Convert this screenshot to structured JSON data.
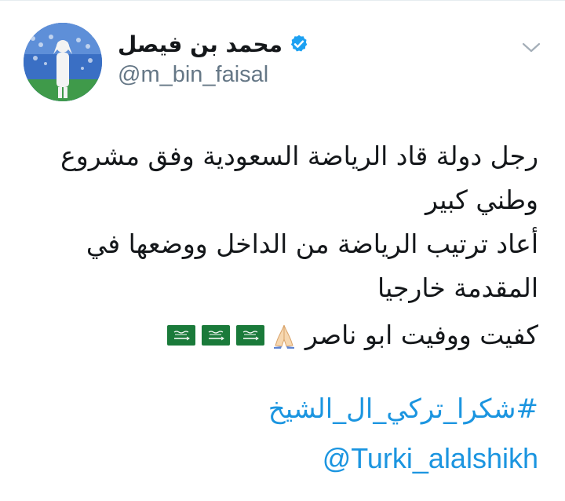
{
  "author": {
    "display_name": "محمد بن فيصل",
    "handle": "@m_bin_faisal",
    "verified": true
  },
  "icons": {
    "avatar": "profile-photo",
    "verified": "verified-badge-icon",
    "more": "chevron-down-icon",
    "flag": "saudi-flag-icon",
    "pray": "folded-hands-icon"
  },
  "tweet": {
    "paragraph1": "رجل دولة قاد الرياضة السعودية وفق مشروع وطني كبير",
    "paragraph2": "أعاد ترتيب الرياضة من الداخل ووضعها في المقدمة خارجيا",
    "paragraph3": "كفيت ووفيت ابو ناصر",
    "hashtag": "#شكرا_تركي_ال_الشيخ",
    "mention": "@Turki_alalshikh"
  },
  "colors": {
    "link": "#1b95e0",
    "verified": "#1da1f2",
    "text": "#14171a",
    "secondary": "#657786",
    "flag_green": "#1a7a3a"
  }
}
